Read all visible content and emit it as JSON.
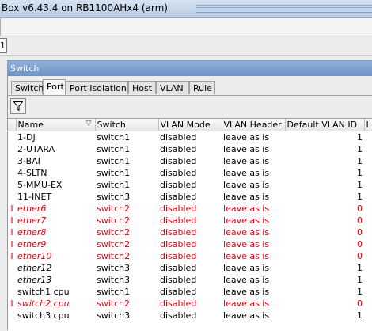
{
  "app_title": "Box v6.43.4 on RB1100AHx4 (arm)",
  "side_box_text": "1",
  "window": {
    "title": "Switch",
    "tabs": [
      "Switch",
      "Port",
      "Port Isolation",
      "Host",
      "VLAN",
      "Rule"
    ],
    "active_tab": "Port"
  },
  "table": {
    "columns": [
      "Name",
      "Switch",
      "VLAN Mode",
      "VLAN Header",
      "Default VLAN ID",
      "I"
    ],
    "rows": [
      {
        "flag": "",
        "name": "1-DJ",
        "switch": "switch1",
        "vlan_mode": "disabled",
        "vlan_header": "leave as is",
        "default_vlan_id": "1",
        "status": "normal"
      },
      {
        "flag": "",
        "name": "2-UTARA",
        "switch": "switch1",
        "vlan_mode": "disabled",
        "vlan_header": "leave as is",
        "default_vlan_id": "1",
        "status": "normal"
      },
      {
        "flag": "",
        "name": "3-BAI",
        "switch": "switch1",
        "vlan_mode": "disabled",
        "vlan_header": "leave as is",
        "default_vlan_id": "1",
        "status": "normal"
      },
      {
        "flag": "",
        "name": "4-SLTN",
        "switch": "switch1",
        "vlan_mode": "disabled",
        "vlan_header": "leave as is",
        "default_vlan_id": "1",
        "status": "normal"
      },
      {
        "flag": "",
        "name": "5-MMU-EX",
        "switch": "switch1",
        "vlan_mode": "disabled",
        "vlan_header": "leave as is",
        "default_vlan_id": "1",
        "status": "normal"
      },
      {
        "flag": "",
        "name": "11-INET",
        "switch": "switch3",
        "vlan_mode": "disabled",
        "vlan_header": "leave as is",
        "default_vlan_id": "1",
        "status": "normal"
      },
      {
        "flag": "I",
        "name": "ether6",
        "switch": "switch2",
        "vlan_mode": "disabled",
        "vlan_header": "leave as is",
        "default_vlan_id": "0",
        "status": "disabled"
      },
      {
        "flag": "I",
        "name": "ether7",
        "switch": "switch2",
        "vlan_mode": "disabled",
        "vlan_header": "leave as is",
        "default_vlan_id": "0",
        "status": "disabled"
      },
      {
        "flag": "I",
        "name": "ether8",
        "switch": "switch2",
        "vlan_mode": "disabled",
        "vlan_header": "leave as is",
        "default_vlan_id": "0",
        "status": "disabled"
      },
      {
        "flag": "I",
        "name": "ether9",
        "switch": "switch2",
        "vlan_mode": "disabled",
        "vlan_header": "leave as is",
        "default_vlan_id": "0",
        "status": "disabled"
      },
      {
        "flag": "I",
        "name": "ether10",
        "switch": "switch2",
        "vlan_mode": "disabled",
        "vlan_header": "leave as is",
        "default_vlan_id": "0",
        "status": "disabled"
      },
      {
        "flag": "",
        "name": "ether12",
        "switch": "switch3",
        "vlan_mode": "disabled",
        "vlan_header": "leave as is",
        "default_vlan_id": "1",
        "status": "italic"
      },
      {
        "flag": "",
        "name": "ether13",
        "switch": "switch3",
        "vlan_mode": "disabled",
        "vlan_header": "leave as is",
        "default_vlan_id": "1",
        "status": "italic"
      },
      {
        "flag": "",
        "name": "switch1 cpu",
        "switch": "switch1",
        "vlan_mode": "disabled",
        "vlan_header": "leave as is",
        "default_vlan_id": "1",
        "status": "normal"
      },
      {
        "flag": "I",
        "name": "switch2 cpu",
        "switch": "switch2",
        "vlan_mode": "disabled",
        "vlan_header": "leave as is",
        "default_vlan_id": "0",
        "status": "disabled"
      },
      {
        "flag": "",
        "name": "switch3 cpu",
        "switch": "switch3",
        "vlan_mode": "disabled",
        "vlan_header": "leave as is",
        "default_vlan_id": "1",
        "status": "normal"
      }
    ]
  },
  "colors": {
    "disabled_text": "#e0000f",
    "title_bar": "#7a9fcf"
  },
  "icons": {
    "filter": "filter-icon",
    "sort": "sort-desc-icon"
  }
}
